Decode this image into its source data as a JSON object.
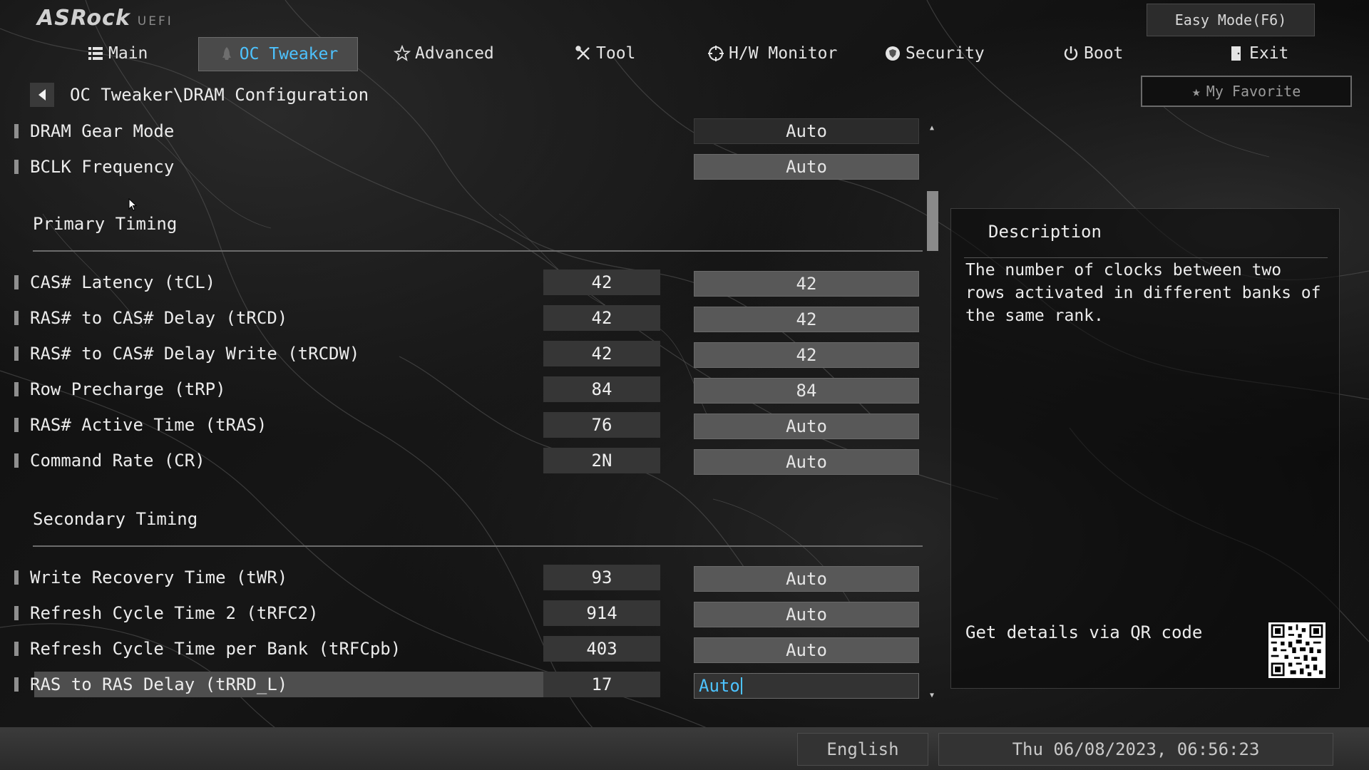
{
  "header": {
    "brand": "ASRock",
    "subtitle": "UEFI",
    "easy_mode_label": "Easy Mode(F6)",
    "favorite_label": "My Favorite"
  },
  "nav": {
    "tabs": [
      {
        "label": "Main",
        "icon": "list-icon",
        "active": false
      },
      {
        "label": "OC Tweaker",
        "icon": "rocket-icon",
        "active": true
      },
      {
        "label": "Advanced",
        "icon": "star-icon",
        "active": false
      },
      {
        "label": "Tool",
        "icon": "tools-icon",
        "active": false
      },
      {
        "label": "H/W Monitor",
        "icon": "crosshair-icon",
        "active": false
      },
      {
        "label": "Security",
        "icon": "shield-icon",
        "active": false
      },
      {
        "label": "Boot",
        "icon": "power-icon",
        "active": false
      },
      {
        "label": "Exit",
        "icon": "door-icon",
        "active": false
      }
    ]
  },
  "breadcrumb": {
    "path": "OC Tweaker\\DRAM Configuration"
  },
  "settings": {
    "top": [
      {
        "label": "DRAM Gear Mode",
        "option": "Auto"
      },
      {
        "label": "BCLK Frequency",
        "option": "Auto"
      }
    ],
    "primary_title": "Primary Timing",
    "primary": [
      {
        "label": "CAS# Latency (tCL)",
        "current": "42",
        "option": "42"
      },
      {
        "label": "RAS# to CAS# Delay (tRCD)",
        "current": "42",
        "option": "42"
      },
      {
        "label": "RAS# to CAS# Delay Write (tRCDW)",
        "current": "42",
        "option": "42"
      },
      {
        "label": "Row Precharge (tRP)",
        "current": "84",
        "option": "84"
      },
      {
        "label": "RAS# Active Time (tRAS)",
        "current": "76",
        "option": "Auto"
      },
      {
        "label": "Command Rate (CR)",
        "current": "2N",
        "option": "Auto"
      }
    ],
    "secondary_title": "Secondary Timing",
    "secondary": [
      {
        "label": "Write Recovery Time (tWR)",
        "current": "93",
        "option": "Auto"
      },
      {
        "label": "Refresh Cycle Time 2 (tRFC2)",
        "current": "914",
        "option": "Auto"
      },
      {
        "label": "Refresh Cycle Time per Bank (tRFCpb)",
        "current": "403",
        "option": "Auto"
      },
      {
        "label": "RAS to RAS Delay (tRRD_L)",
        "current": "17",
        "option": "Auto"
      }
    ]
  },
  "description": {
    "title": "Description",
    "text": "The number of clocks between two rows activated in different banks of the same rank.",
    "qr_label": "Get details via QR code"
  },
  "footer": {
    "language": "English",
    "datetime": "Thu 06/08/2023, 06:56:23"
  },
  "colors": {
    "accent": "#4dc3ff",
    "active_tab_bg": "#4a4a4a",
    "option_bg": "#585858"
  }
}
